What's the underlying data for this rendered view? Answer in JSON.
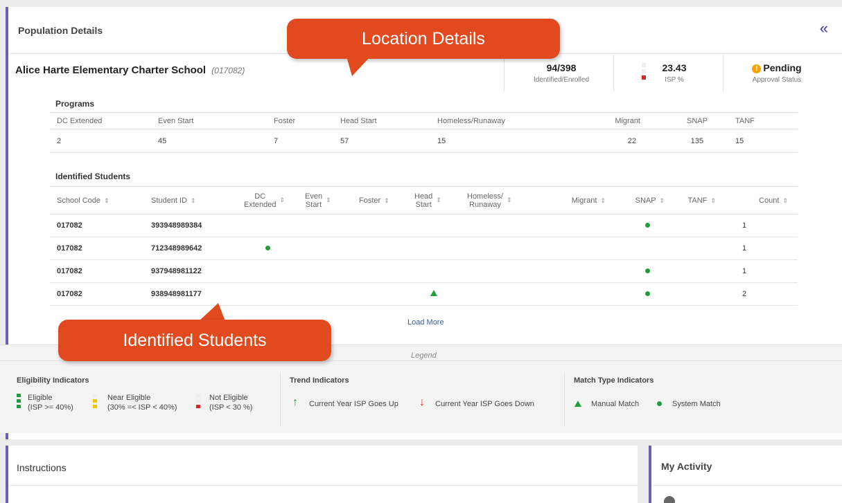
{
  "header": {
    "title": "Population Details",
    "collapse_icon": "double-chevron-left-icon"
  },
  "school": {
    "name": "Alice Harte Elementary Charter School",
    "code": "(017082)"
  },
  "stats": {
    "identified": {
      "value": "94/398",
      "label": "Identified/Enrolled"
    },
    "isp": {
      "value": "23.43",
      "label": "ISP %"
    },
    "approval": {
      "value": "Pending",
      "label": "Approval Status",
      "icon": "!"
    }
  },
  "programs": {
    "title": "Programs",
    "headers": [
      "DC Extended",
      "Even Start",
      "Foster",
      "Head Start",
      "Homeless/Runaway",
      "Migrant",
      "SNAP",
      "TANF"
    ],
    "values": [
      "2",
      "45",
      "7",
      "57",
      "15",
      "22",
      "135",
      "15"
    ]
  },
  "students": {
    "title": "Identified Students",
    "headers": {
      "school_code": "School Code",
      "student_id": "Student ID",
      "dc_line1": "DC",
      "dc_line2": "Extended",
      "even_line1": "Even",
      "even_line2": "Start",
      "foster": "Foster",
      "head_line1": "Head",
      "head_line2": "Start",
      "home_line1": "Homeless/",
      "home_line2": "Runaway",
      "migrant": "Migrant",
      "snap": "SNAP",
      "tanf": "TANF",
      "count": "Count",
      "sort_icon": "⇕"
    },
    "rows": [
      {
        "school_code": "017082",
        "student_id": "393948989384",
        "match": "SNAP system match",
        "count": "1"
      },
      {
        "school_code": "017082",
        "student_id": "712348989642",
        "match": "DC Extended system match",
        "count": "1"
      },
      {
        "school_code": "017082",
        "student_id": "937948981122",
        "match": "SNAP system match",
        "count": "1"
      },
      {
        "school_code": "017082",
        "student_id": "938948981177",
        "match": "Head Start manual match, SNAP system match",
        "count": "2"
      }
    ],
    "load_more": "Load More"
  },
  "legend": {
    "title": "Legend",
    "eligibility": {
      "title": "Eligibility Indicators",
      "eligible_1": "Eligible",
      "eligible_2": "(ISP >= 40%)",
      "near_1": "Near Eligible",
      "near_2": "(30% =< ISP < 40%)",
      "not_1": "Not Eligible",
      "not_2": "(ISP < 30 %)"
    },
    "trend": {
      "title": "Trend Indicators",
      "up": "Current Year ISP Goes Up",
      "down": "Current Year ISP Goes Down"
    },
    "match": {
      "title": "Match Type Indicators",
      "manual": "Manual Match",
      "system": "System Match"
    }
  },
  "instructions": {
    "title": "Instructions"
  },
  "activity": {
    "title": "My Activity"
  },
  "callouts": {
    "location": "Location Details",
    "students": "Identified Students"
  },
  "colors": {
    "accent": "#6b5fb5",
    "callout": "#e04a1e",
    "green": "#1f9e3a",
    "red": "#d9232d",
    "yellow": "#f2c200",
    "link": "#2e5ea8"
  }
}
